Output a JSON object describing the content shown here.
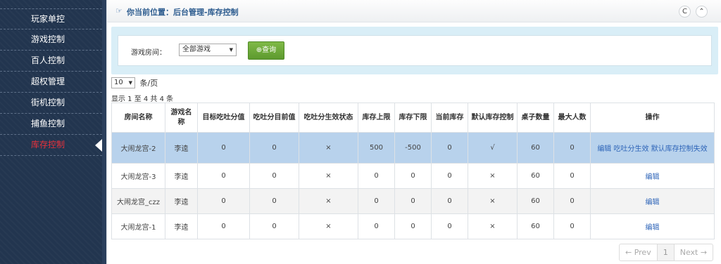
{
  "sidebar": {
    "items": [
      {
        "label": "玩家单控",
        "name": "sidebar-item-player-control"
      },
      {
        "label": "游戏控制",
        "name": "sidebar-item-game-control"
      },
      {
        "label": "百人控制",
        "name": "sidebar-item-hundred-control"
      },
      {
        "label": "超权管理",
        "name": "sidebar-item-super-admin"
      },
      {
        "label": "街机控制",
        "name": "sidebar-item-arcade-control"
      },
      {
        "label": "捕鱼控制",
        "name": "sidebar-item-fishing-control"
      },
      {
        "label": "库存控制",
        "name": "sidebar-item-stock-control",
        "active": true
      }
    ]
  },
  "header": {
    "location": "你当前位置：后台管理-库存控制",
    "hand_icon": "☞",
    "refresh_icon": "C",
    "collapse_icon": "⌃"
  },
  "filter": {
    "room_label": "游戏房间：",
    "room_value": "全部游戏",
    "query_label": "⊕查询"
  },
  "paging": {
    "per_page": "10",
    "per_page_unit": "条/页",
    "summary": "显示 1 至 4 共 4 条",
    "prev": "← Prev",
    "page": "1",
    "next": "Next →"
  },
  "table": {
    "headers": [
      "房间名称",
      "游戏名称",
      "目标吃吐分值",
      "吃吐分目前值",
      "吃吐分生效状态",
      "库存上限",
      "库存下限",
      "当前库存",
      "默认库存控制",
      "桌子数量",
      "最大人数",
      "操作"
    ],
    "rows": [
      {
        "cells": [
          "大闹龙宫-2",
          "李逵",
          "0",
          "0",
          "×",
          "500",
          "-500",
          "0",
          "√",
          "60",
          "0"
        ],
        "actions": [
          "编辑",
          "吃吐分生效",
          "默认库存控制失效"
        ],
        "style": "sel"
      },
      {
        "cells": [
          "大闹龙宫-3",
          "李逵",
          "0",
          "0",
          "×",
          "0",
          "0",
          "0",
          "×",
          "60",
          "0"
        ],
        "actions": [
          "编辑"
        ],
        "style": ""
      },
      {
        "cells": [
          "大闹龙宫_czz",
          "李逵",
          "0",
          "0",
          "×",
          "0",
          "0",
          "0",
          "×",
          "60",
          "0"
        ],
        "actions": [
          "编辑"
        ],
        "style": "alt"
      },
      {
        "cells": [
          "大闹龙宫-1",
          "李逵",
          "0",
          "0",
          "×",
          "0",
          "0",
          "0",
          "×",
          "60",
          "0"
        ],
        "actions": [
          "编辑"
        ],
        "style": ""
      }
    ]
  }
}
